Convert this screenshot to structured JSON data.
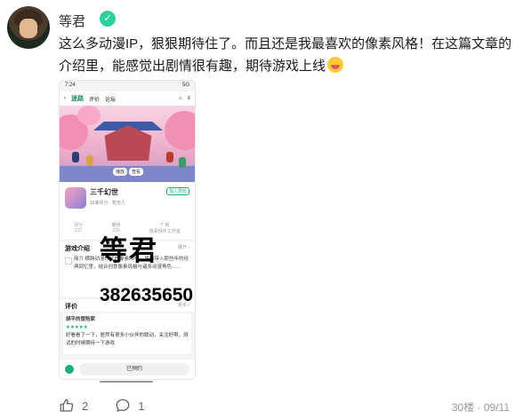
{
  "user": {
    "name": "等君",
    "badge_icon": "verified-badge-icon"
  },
  "comment": {
    "text": "这么多动漫IP，狠狠期待住了。而且还是我最喜欢的像素风格！在这篇文章的介绍里，能感觉出剧情很有趣，期待游戏上线",
    "emoji_icon": "laughing-face-emoji-icon"
  },
  "screenshot": {
    "status_time": "7:24",
    "status_right": "5G",
    "nav": {
      "back": "‹",
      "logo": "迷路",
      "tab_reviews": "评价",
      "tab_forum": "论坛"
    },
    "banner_buttons": [
      "播放",
      "查看"
    ],
    "game": {
      "name": "三千幻世",
      "sub": "16家评分 · 暂无人",
      "follow": "加入想玩"
    },
    "stats": [
      {
        "label": "评分",
        "value": "217"
      },
      {
        "label": "期待",
        "value": "215"
      },
      {
        "label": "厂商",
        "value": "像素情怀工作室"
      }
    ],
    "intro": {
      "title": "游戏介绍",
      "more": "展开 ›",
      "body": "简介 横跨动漫时代的像素RPG，将你带入那些年的经典回忆里，结合创意像素风格与诸多动漫角色……"
    },
    "reviews": {
      "title": "评价",
      "more": "更多 ›",
      "card": {
        "who": "胡平的冒险家",
        "stars": "★★★★★",
        "text": "好看看了一下，居然有很多小伙伴的联动，关注好啊，测试的时候期待一下游戏"
      }
    },
    "bottom": {
      "booked": "已预约"
    }
  },
  "watermark": {
    "name": "等君",
    "id": "382635650"
  },
  "actions": {
    "likes": "2",
    "replies": "1"
  },
  "meta": {
    "floor": "30楼 · 09/11"
  }
}
